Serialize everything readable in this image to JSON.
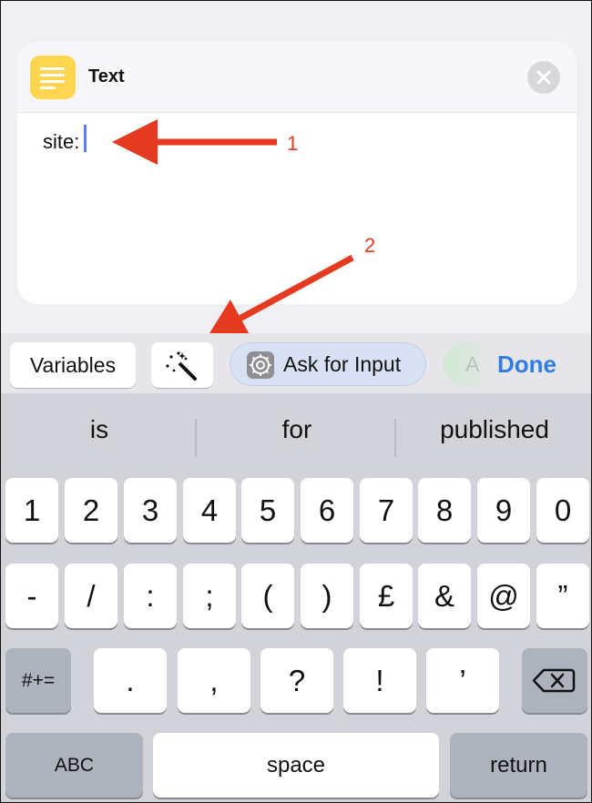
{
  "card": {
    "title": "Text",
    "text": "site:",
    "icon": "text-doc-icon",
    "close_icon": "close-icon"
  },
  "annotations": {
    "label_1": "1",
    "label_2": "2",
    "color": "#e53a1f"
  },
  "toolbar": {
    "variables_label": "Variables",
    "magic_icon": "magic-wand-icon",
    "ask_label": "Ask for Input",
    "ask_icon": "gear-icon",
    "partial_label": "A",
    "done_label": "Done",
    "accent": "#2f7de1"
  },
  "suggestions": [
    "is",
    "for",
    "published"
  ],
  "keyboard": {
    "row1": [
      "1",
      "2",
      "3",
      "4",
      "5",
      "6",
      "7",
      "8",
      "9",
      "0"
    ],
    "row2": [
      "-",
      "/",
      ":",
      ";",
      "(",
      ")",
      "£",
      "&",
      "@",
      "”"
    ],
    "row3": [
      ".",
      ",",
      "?",
      "!",
      "’"
    ],
    "symbols_label": "#+=",
    "abc_label": "ABC",
    "space_label": "space",
    "return_label": "return",
    "delete_icon": "backspace-icon"
  }
}
